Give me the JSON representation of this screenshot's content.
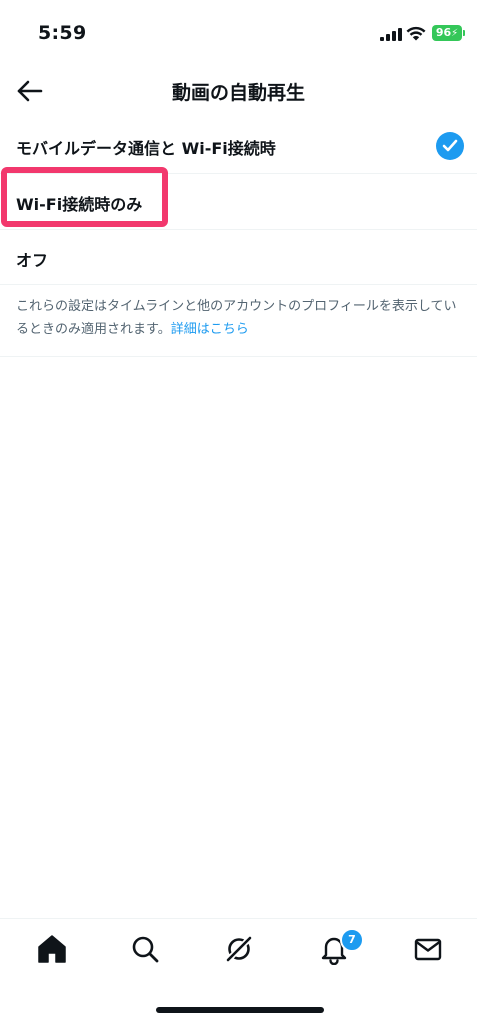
{
  "status_bar": {
    "time": "5:59",
    "battery_level": "96",
    "battery_color": "#34c759"
  },
  "header": {
    "title": "動画の自動再生",
    "back_icon": "arrow-left-icon"
  },
  "options": [
    {
      "label": "モバイルデータ通信と Wi-Fi接続時",
      "selected": true
    },
    {
      "label": "Wi-Fi接続時のみ",
      "selected": false,
      "highlighted": true
    },
    {
      "label": "オフ",
      "selected": false
    }
  ],
  "description": {
    "text": "これらの設定はタイムラインと他のアカウントのプロフィールを表示しているときのみ適用されます。",
    "link": "詳細はこちら"
  },
  "tab_bar": {
    "items": [
      {
        "name": "home",
        "icon": "home-icon",
        "active": true
      },
      {
        "name": "search",
        "icon": "search-icon"
      },
      {
        "name": "spaces",
        "icon": "spaces-icon"
      },
      {
        "name": "notifications",
        "icon": "bell-icon",
        "badge": "7"
      },
      {
        "name": "messages",
        "icon": "mail-icon"
      }
    ]
  },
  "colors": {
    "accent": "#1d9bf0",
    "highlight": "#f2386d",
    "text": "#0f1419",
    "secondary_text": "#536471"
  }
}
